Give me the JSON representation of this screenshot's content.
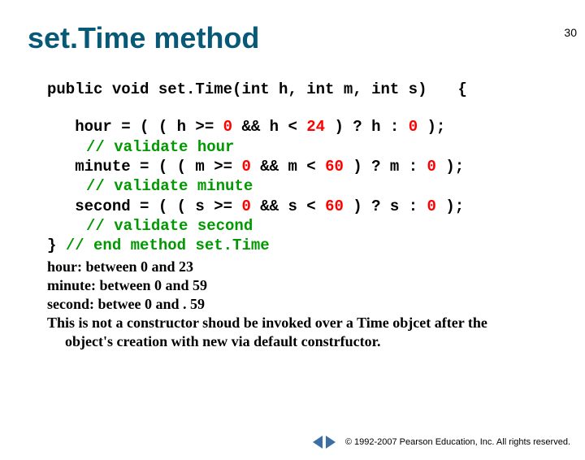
{
  "page_number": "30",
  "title": "set.Time method",
  "code": {
    "signature": "public void set.Time(int h, int m, int s)",
    "open_brace": "{",
    "hour_pre": "   hour = ( ( h >= ",
    "zero1": "0",
    "hour_mid": " && h < ",
    "num24": "24",
    "hour_post": " ) ? h : ",
    "zero2": "0",
    "hour_end": " );",
    "hour_comment": "// validate hour",
    "minute_pre": "   minute = ( ( m >= ",
    "zero3": "0",
    "minute_mid": " && m < ",
    "num60a": "60",
    "minute_post": " ) ? m : ",
    "zero4": "0",
    "minute_end": " );",
    "minute_comment": "// validate minute",
    "second_pre": "   second = ( ( s >= ",
    "zero5": "0",
    "second_mid": " && s < ",
    "num60b": "60",
    "second_post": " ) ? s : ",
    "zero6": "0",
    "second_end": " );",
    "second_comment": "// validate second",
    "close_brace": "} ",
    "end_comment": "// end method set.Time"
  },
  "notes": {
    "n1": "hour:  between 0 and 23",
    "n2": "minute: between 0 and 59",
    "n3": "second: betwee 0 and . 59",
    "n4a": "This is not a constructor shoud be invoked over a Time objcet after the",
    "n4b": "object's creation with new via default constrfuctor."
  },
  "footer": {
    "copyright": "© 1992-2007 Pearson Education, Inc. All rights reserved."
  }
}
